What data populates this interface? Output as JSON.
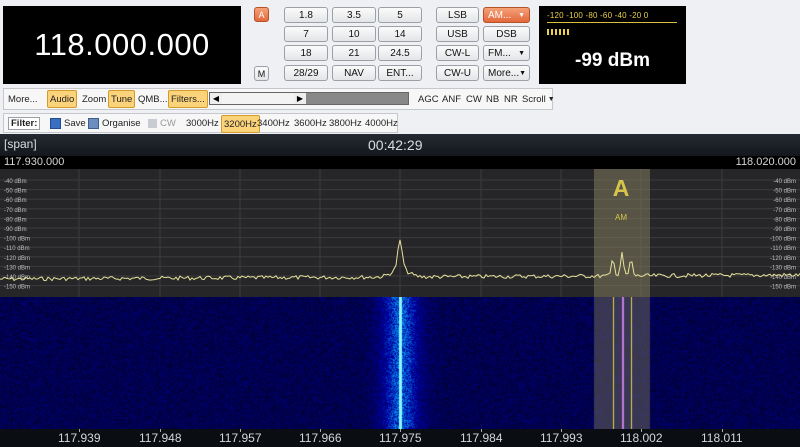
{
  "frequency_display": "118.000.000",
  "left_buttons": {
    "a": "A",
    "m": "M"
  },
  "band_buttons": [
    "1.8",
    "3.5",
    "5",
    "7",
    "10",
    "14",
    "18",
    "21",
    "24.5",
    "28/29",
    "NAV",
    "ENT..."
  ],
  "mode_buttons": {
    "lsb": "LSB",
    "usb": "USB",
    "cwl": "CW-L",
    "cwu": "CW-U",
    "am": "AM...",
    "dsb": "DSB",
    "fm": "FM...",
    "more": "More..."
  },
  "smeter": {
    "scale": "-120 -100 -80 -60 -40 -20  0",
    "value": "-99 dBm"
  },
  "toolbar": {
    "more": "More...",
    "audio": "Audio",
    "zoom": "Zoom",
    "tune": "Tune",
    "qmb": "QMB...",
    "filters": "Filters...",
    "agc": "AGC",
    "anf": "ANF",
    "cw": "CW",
    "nb": "NB",
    "nr": "NR",
    "scroll": "Scroll"
  },
  "filterbar": {
    "label": "Filter:",
    "save": "Save",
    "organise": "Organise",
    "cw": "CW",
    "bandwidths": [
      "3000Hz",
      "3200Hz",
      "3400Hz",
      "3600Hz",
      "3800Hz",
      "4000Hz"
    ],
    "selected": "3200Hz"
  },
  "spectrum": {
    "span_label": "[span]",
    "time": "00:42:29",
    "start_freq": "117.930.000",
    "end_freq": "118.020.000",
    "dbm_labels": [
      "-40 dBm",
      "-50 dBm",
      "-60 dBm",
      "-70 dBm",
      "-80 dBm",
      "-90 dBm",
      "-100 dBm",
      "-110 dBm",
      "-120 dBm",
      "-130 dBm",
      "-140 dBm",
      "-150 dBm"
    ],
    "mode_marker_letter": "A",
    "mode_marker_text": "AM",
    "axis_ticks": [
      "117.939",
      "117.948",
      "117.957",
      "117.966",
      "117.975",
      "117.984",
      "117.993",
      "118.002",
      "118.011"
    ]
  },
  "colors": {
    "accent": "#e4683c",
    "spectrum_trace": "#e8e39a",
    "waterfall_signal": "#8ff4ff",
    "filter_band": "#7f7a5c"
  }
}
